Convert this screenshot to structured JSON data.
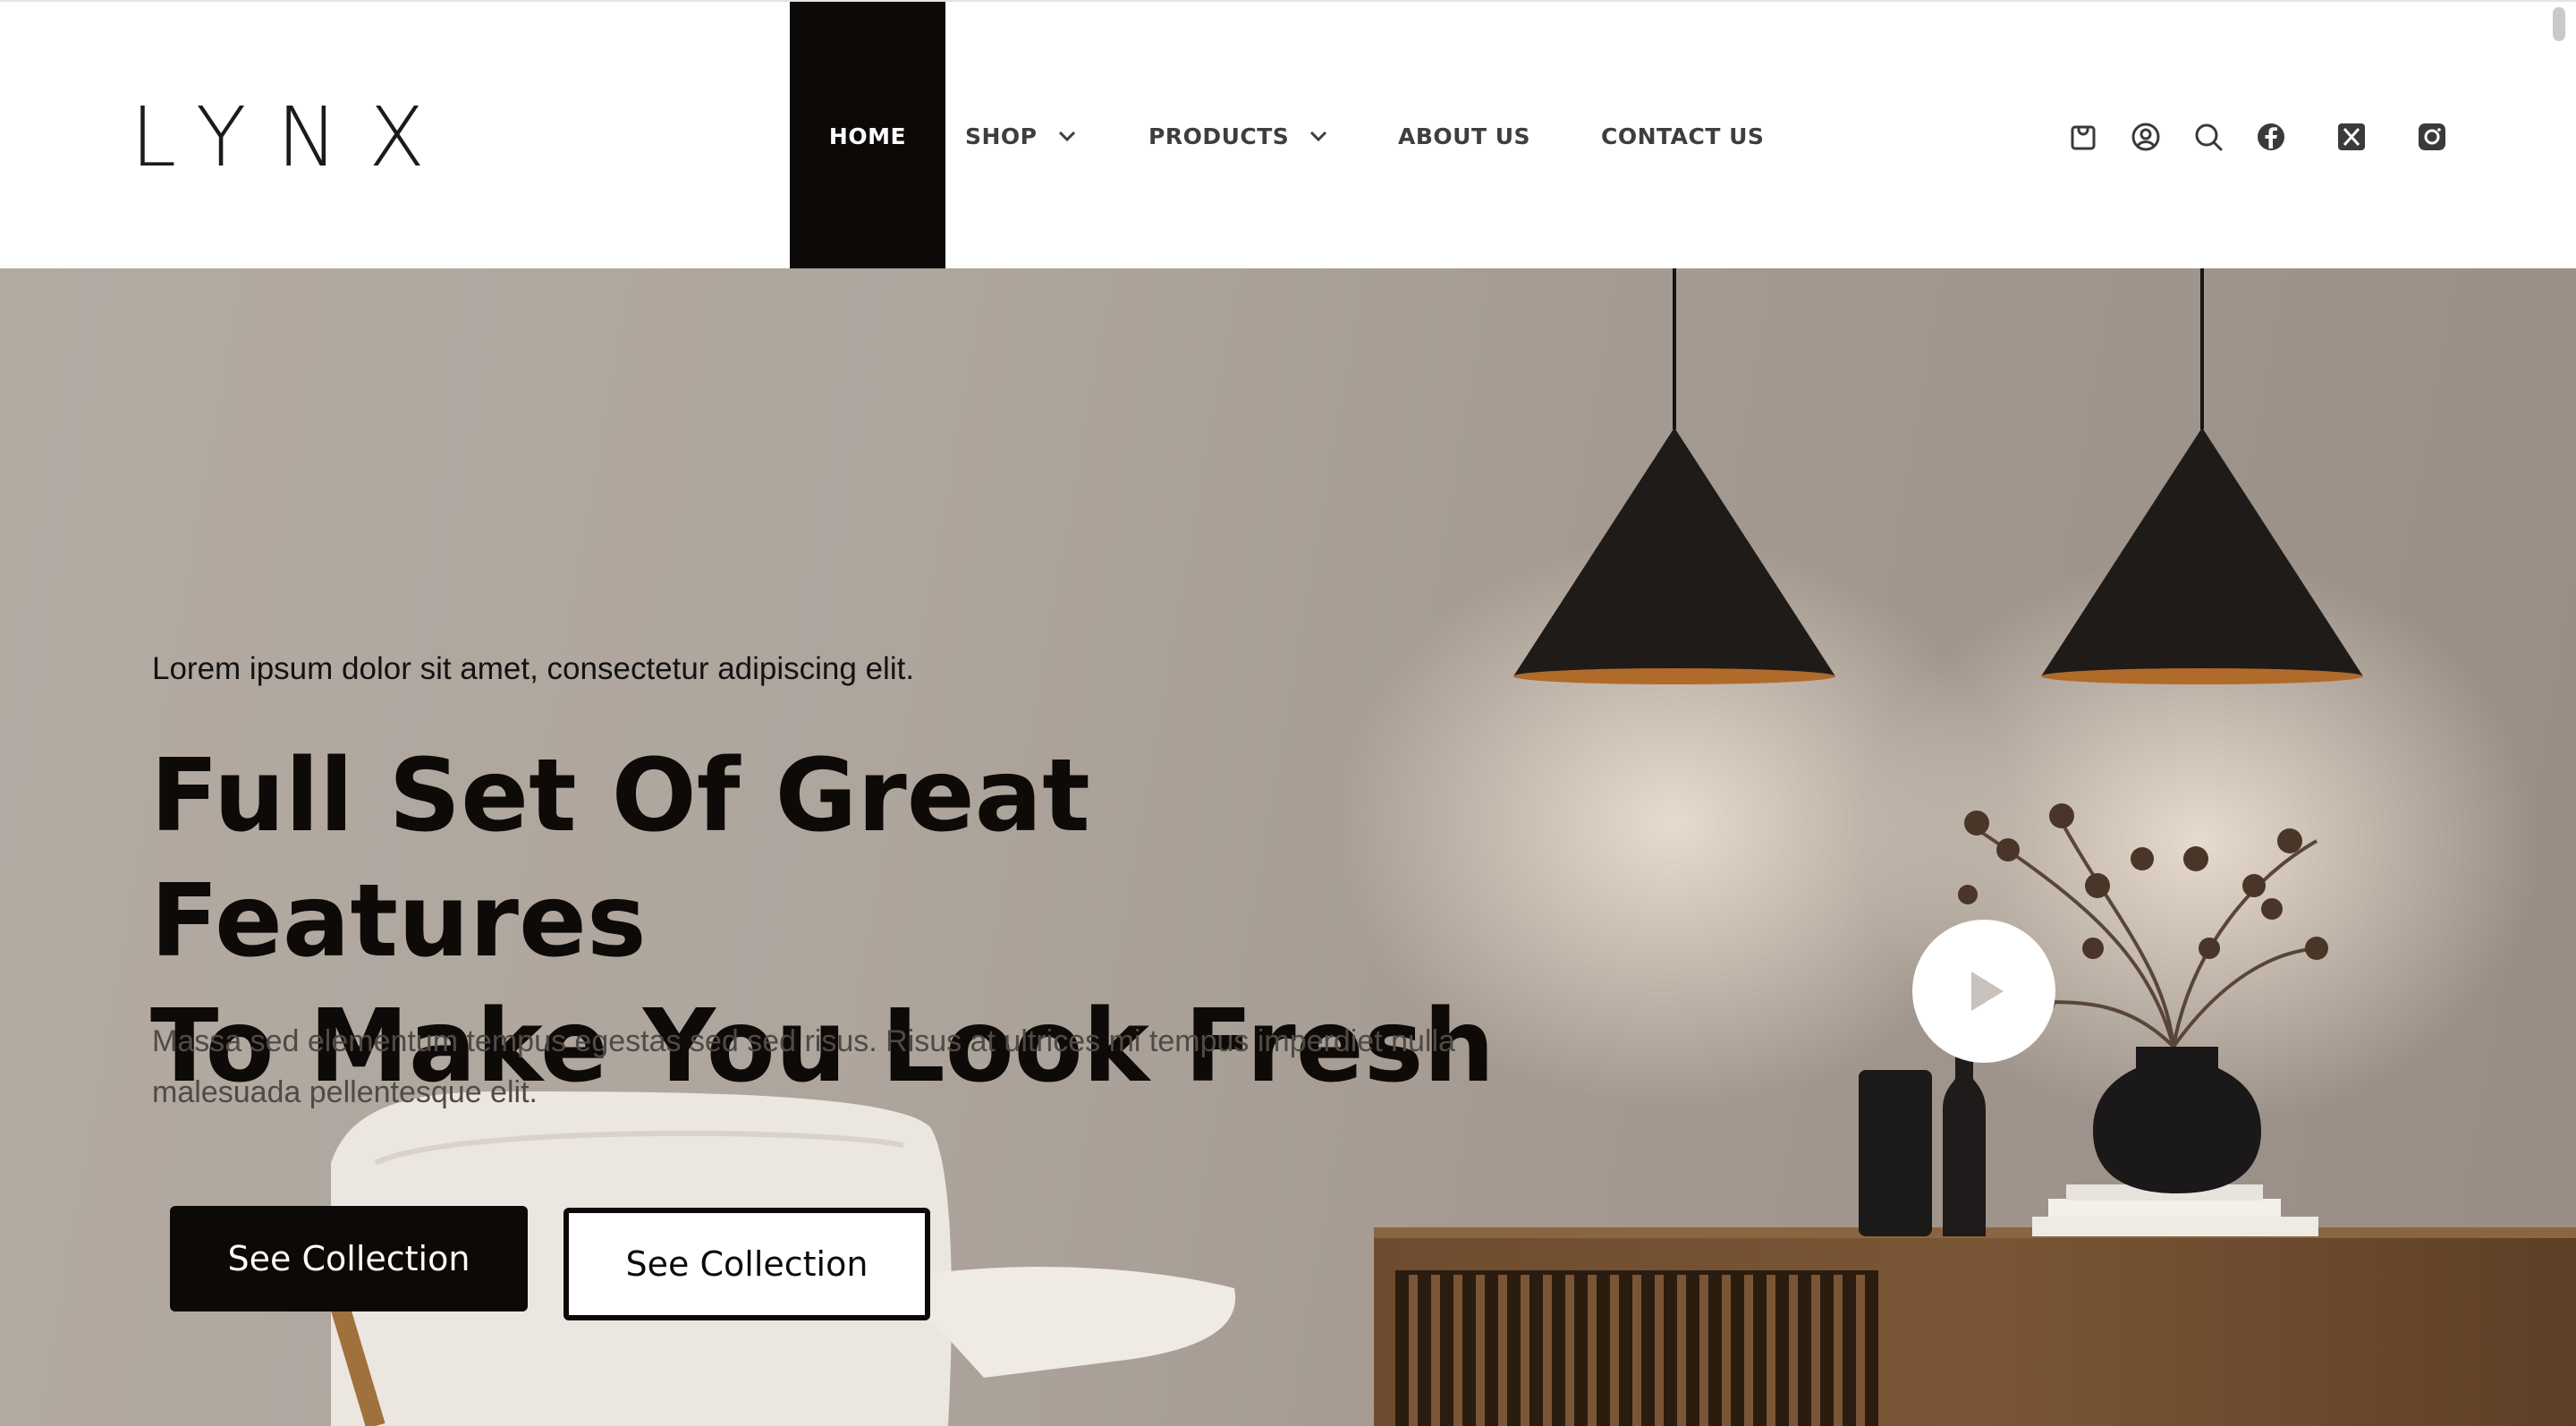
{
  "header": {
    "logo": "LYNX",
    "nav": [
      {
        "label": "HOME",
        "active": true
      },
      {
        "label": "SHOP",
        "dropdown": true
      },
      {
        "label": "PRODUCTS",
        "dropdown": true
      },
      {
        "label": "ABOUT US"
      },
      {
        "label": "CONTACT US"
      }
    ],
    "icons": [
      "cart-icon",
      "user-icon",
      "search-icon",
      "facebook-icon",
      "x-twitter-icon",
      "instagram-icon"
    ]
  },
  "hero": {
    "kicker": "Lorem ipsum dolor sit amet, consectetur adipiscing elit.",
    "title_line1": "Full Set Of Great Features",
    "title_line2": "To Make You Look Fresh",
    "subtitle": "Massa sed elementum tempus egestas sed sed risus. Risus at ultrices mi tempus imperdiet nulla malesuada pellentesque elit.",
    "primary_button": "See Collection",
    "secondary_button": "See Collection",
    "play_button": "play-icon"
  },
  "colors": {
    "accent_dark": "#0d0906",
    "nav_text": "#3e3e3e",
    "wall": "#aea59d",
    "wood": "#6b4a2e"
  }
}
